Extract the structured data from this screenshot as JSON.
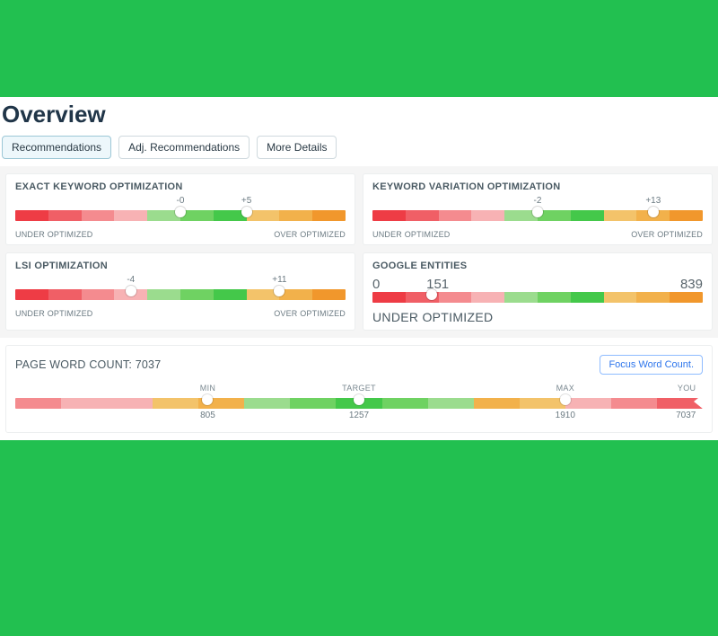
{
  "title": "Overview",
  "tabs": [
    {
      "label": "Recommendations",
      "active": true
    },
    {
      "label": "Adj. Recommendations",
      "active": false
    },
    {
      "label": "More Details",
      "active": false
    }
  ],
  "gauges": {
    "exact": {
      "title": "EXACT KEYWORD OPTIMIZATION",
      "lo_label": "-0",
      "hi_label": "+5",
      "lo_pct": 50,
      "hi_pct": 70,
      "under": "UNDER OPTIMIZED",
      "over": "OVER OPTIMIZED"
    },
    "variation": {
      "title": "KEYWORD VARIATION OPTIMIZATION",
      "lo_label": "-2",
      "hi_label": "+13",
      "lo_pct": 50,
      "hi_pct": 85,
      "under": "UNDER OPTIMIZED",
      "over": "OVER OPTIMIZED"
    },
    "lsi": {
      "title": "LSI OPTIMIZATION",
      "lo_label": "-4",
      "hi_label": "+11",
      "lo_pct": 35,
      "hi_pct": 80,
      "under": "UNDER OPTIMIZED",
      "over": "OVER OPTIMIZED"
    },
    "entities": {
      "title": "GOOGLE ENTITIES",
      "left_val": "0",
      "mid_val": "151",
      "right_val": "839",
      "marker_pct": 18,
      "under": "UNDER OPTIMIZED"
    }
  },
  "wordcount": {
    "title_prefix": "PAGE WORD COUNT: ",
    "value": "7037",
    "button": "Focus Word Count.",
    "min_label": "MIN",
    "target_label": "TARGET",
    "max_label": "MAX",
    "you_label": "YOU",
    "min": "805",
    "target": "1257",
    "max": "1910",
    "you": "7037",
    "min_pct": 28,
    "target_pct": 50,
    "max_pct": 80,
    "you_pct": 99
  }
}
